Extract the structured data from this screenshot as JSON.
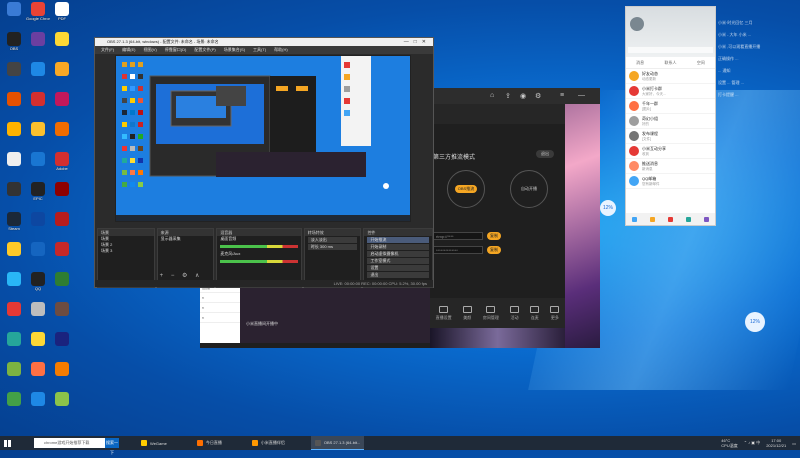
{
  "desktop": {
    "icons": [
      {
        "label": "",
        "color": "#3a7bd5"
      },
      {
        "label": "Google Chrome",
        "color": "#e94335"
      },
      {
        "label": "PDF",
        "color": "#ffffff"
      },
      {
        "label": "OBS",
        "color": "#222222"
      },
      {
        "label": "",
        "color": "#6b3fa0"
      },
      {
        "label": "",
        "color": "#fdd835"
      },
      {
        "label": "",
        "color": "#444444"
      },
      {
        "label": "",
        "color": "#1e88e5"
      },
      {
        "label": "",
        "color": "#f9a825"
      },
      {
        "label": "",
        "color": "#e65100"
      },
      {
        "label": "",
        "color": "#d32f2f"
      },
      {
        "label": "",
        "color": "#c2185b"
      },
      {
        "label": "",
        "color": "#ffb300"
      },
      {
        "label": "",
        "color": "#fbc02d"
      },
      {
        "label": "",
        "color": "#ef6c00"
      },
      {
        "label": "",
        "color": "#eeeeee"
      },
      {
        "label": "",
        "color": "#1976d2"
      },
      {
        "label": "Adobe",
        "color": "#d32f2f"
      },
      {
        "label": "",
        "color": "#333333"
      },
      {
        "label": "EPIC",
        "color": "#222222"
      },
      {
        "label": "",
        "color": "#8e0000"
      },
      {
        "label": "Steam",
        "color": "#1b2838"
      },
      {
        "label": "",
        "color": "#0d47a1"
      },
      {
        "label": "",
        "color": "#b71c1c"
      },
      {
        "label": "",
        "color": "#ffca28"
      },
      {
        "label": "",
        "color": "#1565c0"
      },
      {
        "label": "",
        "color": "#c62828"
      },
      {
        "label": "",
        "color": "#29b6f6"
      },
      {
        "label": "QQ",
        "color": "#222222"
      },
      {
        "label": "",
        "color": "#2e7d32"
      },
      {
        "label": "",
        "color": "#e53935"
      },
      {
        "label": "",
        "color": "#bdbdbd"
      },
      {
        "label": "",
        "color": "#6d4c41"
      },
      {
        "label": "",
        "color": "#26a69a"
      },
      {
        "label": "",
        "color": "#fdd835"
      },
      {
        "label": "",
        "color": "#1a237e"
      },
      {
        "label": "",
        "color": "#7cb342"
      },
      {
        "label": "",
        "color": "#ff7043"
      },
      {
        "label": "",
        "color": "#f57c00"
      },
      {
        "label": "",
        "color": "#43a047"
      },
      {
        "label": "",
        "color": "#1e88e5"
      },
      {
        "label": "",
        "color": "#8bc34a"
      }
    ]
  },
  "obs": {
    "title": "OBS 27.1.3 (64-bit, windows) - 配置文件: 未命名 - 场景: 未命名",
    "menu": [
      "文件(F)",
      "编辑(E)",
      "视图(V)",
      "停靠窗口(D)",
      "配置文件(P)",
      "场景集合(S)",
      "工具(T)",
      "帮助(H)"
    ],
    "docks": {
      "scenes": {
        "title": "场景",
        "rows": [
          "场景",
          "场景 2",
          "场景 3"
        ]
      },
      "sources": {
        "title": "来源",
        "rows": [
          "显示器采集"
        ]
      },
      "mixer": {
        "title": "混音器",
        "tracks": [
          "桌面音频",
          "麦克风/Aux"
        ]
      },
      "transitions": {
        "title": "转场特效",
        "rows": [
          "淡入淡出",
          "时长 300 ms"
        ]
      },
      "controls": {
        "title": "控件",
        "buttons": [
          "开始推流",
          "开始录制",
          "启动虚拟摄像机",
          "工作室模式",
          "设置",
          "退出"
        ]
      }
    },
    "status": "LIVE: 00:00:00   REC: 00:00:00   CPU: 5.2%, 30.00 fps"
  },
  "stream_app": {
    "mode_title": "第三方推流模式",
    "close_label": "退出",
    "option_left": "OBS推流",
    "option_left_sub": "第三方推流",
    "option_right": "自动开播",
    "copy_label": "复制",
    "bottom_items": [
      "直播设置",
      "美颜",
      "房间管理",
      "活动",
      "连麦",
      "更多"
    ],
    "video_caption": "小米直播间开播中",
    "tabs_label": "直播"
  },
  "qq": {
    "tabs": [
      "消息",
      "联系人",
      "空间"
    ],
    "rows": [
      {
        "name": "好友动态",
        "msg": "动态更新",
        "color": "#f5a623"
      },
      {
        "name": "小米打卡群",
        "msg": "大家好，今天...",
        "color": "#e53935"
      },
      {
        "name": "千年一群",
        "msg": "[图片]",
        "color": "#ff7043"
      },
      {
        "name": "奇幻小组",
        "msg": "好的",
        "color": "#9e9e9e"
      },
      {
        "name": "发布课程",
        "msg": "[文件]",
        "color": "#757575"
      },
      {
        "name": "小米互动分享",
        "msg": "收到",
        "color": "#e53935"
      },
      {
        "name": "推送消息",
        "msg": "新消息",
        "color": "#ff8a65"
      },
      {
        "name": "QQ邮箱",
        "msg": "您有新邮件",
        "color": "#42a5f5"
      }
    ],
    "bg_rows": [
      "小米·时光回忆 三月",
      "小米 - 大年 小米 ...",
      "小米 ,可以观看直播开播",
      "正确操作 ...",
      "... 通知",
      "设置 ... 管理 ...",
      "打卡提醒 ..."
    ]
  },
  "badges": {
    "net_speed": "12%",
    "cpu_badge": "12%"
  },
  "taskbar": {
    "search_text": "chrome游戏开始推荐下载",
    "search_go": "搜索一下",
    "apps": [
      {
        "label": "WeGame",
        "color": "#ffcc00"
      },
      {
        "label": "今日直播",
        "color": "#ff6f00"
      },
      {
        "label": "小米直播伴侣",
        "color": "#ff9800"
      },
      {
        "label": "OBS 27.1.3 (64-bit...",
        "color": "#555555"
      }
    ],
    "tray_label": "46°C\nCPU温度",
    "time": "17:00",
    "date": "2021/12/21"
  }
}
